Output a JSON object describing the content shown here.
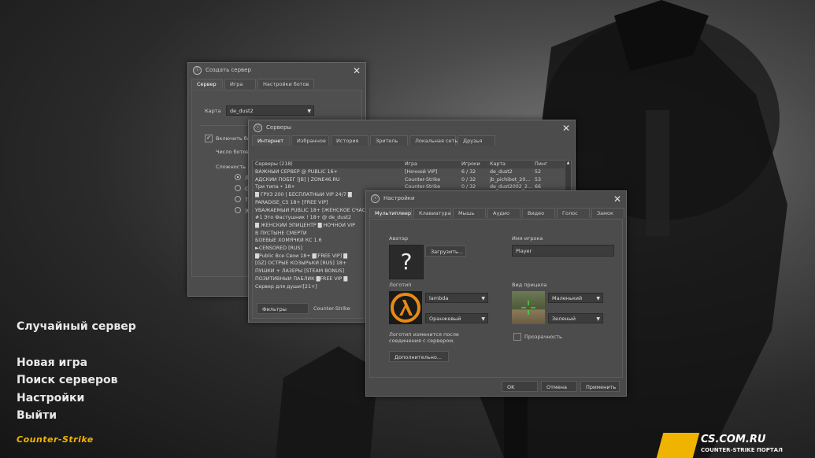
{
  "menu": {
    "random_server": "Случайный сервер",
    "new_game": "Новая игра",
    "find_servers": "Поиск серверов",
    "settings": "Настройки",
    "quit": "Выйти"
  },
  "logo_left": "Counter-Strike",
  "watermark": {
    "site": "CS.COM.RU",
    "sub": "COUNTER-STRIKE ПОРТАЛ"
  },
  "create_server": {
    "title": "Создать сервер",
    "tabs": [
      "Сервер",
      "Игра",
      "Настройки ботов"
    ],
    "map_label": "Карта",
    "map_value": "de_dust2",
    "enable_bots": "Включить бот",
    "bot_count": "Число ботов",
    "difficulty": "Сложность",
    "difficulty_options": [
      "Л",
      "Ср",
      "Тя",
      "Эк"
    ]
  },
  "servers": {
    "title": "Серверы",
    "tabs": [
      "Интернет",
      "Избранное",
      "История",
      "Зритель",
      "Локальная сеть",
      "Друзья"
    ],
    "columns": [
      "Серверы (218)",
      "Игра",
      "Игроки",
      "Карта",
      "Пинг"
    ],
    "rows": [
      {
        "name": "ВАЖНЫЙ СЕРВЕР @ PUBLIC 16+",
        "game": "[Ночной VIP]",
        "players": "6 / 32",
        "map": "de_dust2",
        "ping": "52"
      },
      {
        "name": "АДСКИЙ ПОБЕГ [JB] | ZONE46.RU",
        "game": "Counter-Strike",
        "players": "0 / 32",
        "map": "jb_pichibot_20…",
        "ping": "53"
      },
      {
        "name": "Три типа • 18+",
        "game": "Counter-Strike",
        "players": "0 / 32",
        "map": "de_dust2002_2…",
        "ping": "66"
      },
      {
        "name": "█ ГРУЗ 200 | БЕСПЛАТНЫЙ VIP 24/7 █",
        "game": "",
        "players": "",
        "map": "",
        "ping": ""
      },
      {
        "name": "PARADISE_CS 18+ [FREE VIP]",
        "game": "",
        "players": "",
        "map": "",
        "ping": ""
      },
      {
        "name": "УВАЖАЕМЫЙ PUBLIC 18+ [ЖЕНСКОЕ СЧАС",
        "game": "",
        "players": "",
        "map": "",
        "ping": ""
      },
      {
        "name": "#1 Это Фастушник ! 18+ @ de_dust2",
        "game": "",
        "players": "",
        "map": "",
        "ping": ""
      },
      {
        "name": "█ ЖЕНСКИЙ ЭПИЦЕНТР █ НОЧНОЙ VIP",
        "game": "",
        "players": "",
        "map": "",
        "ping": ""
      },
      {
        "name": "В ПУСТЫНЕ СМЕРТИ",
        "game": "",
        "players": "",
        "map": "",
        "ping": ""
      },
      {
        "name": "БОЕВЫЕ ХОМЯЧКИ КС 1.6",
        "game": "",
        "players": "",
        "map": "",
        "ping": ""
      },
      {
        "name": "►CENSORED [RUS]",
        "game": "",
        "players": "",
        "map": "",
        "ping": ""
      },
      {
        "name": "█Public Все Свои 18+ █[FREE VIP] █",
        "game": "",
        "players": "",
        "map": "",
        "ping": ""
      },
      {
        "name": "[GZ] ОСТРЫЕ КОЗЫРЬКИ [RUS] 18+",
        "game": "",
        "players": "",
        "map": "",
        "ping": ""
      },
      {
        "name": "ПУШКИ + ЛАЗЕРЫ [STEAM BONUS]",
        "game": "",
        "players": "",
        "map": "",
        "ping": ""
      },
      {
        "name": "ПОЗИТИВНЫЙ ПАБЛИК █FREE VIP █",
        "game": "",
        "players": "",
        "map": "",
        "ping": ""
      },
      {
        "name": "Сервер для души![21+]",
        "game": "",
        "players": "",
        "map": "",
        "ping": ""
      }
    ],
    "filters_button": "Фильтры",
    "filter_value": "Counter-Strike"
  },
  "settings": {
    "title": "Настройки",
    "tabs": [
      "Мультиплеер",
      "Клавиатура",
      "Мышь",
      "Аудио",
      "Видео",
      "Голос",
      "Замок"
    ],
    "avatar_label": "Аватар",
    "avatar_placeholder": "?",
    "upload_button": "Загрузить...",
    "player_name_label": "Имя игрока",
    "player_name_value": "Player",
    "logo_label": "Логотип",
    "logo_value": "lambda",
    "logo_color": "Оранжевый",
    "crosshair_label": "Вид прицела",
    "crosshair_size": "Маленький",
    "crosshair_color": "Зеленый",
    "transparency_label": "Прозрачность",
    "logo_note": "Логотип изменится после соединения с сервером.",
    "advanced_button": "Дополнительно...",
    "ok_button": "OK",
    "cancel_button": "Отмена",
    "apply_button": "Применить"
  },
  "colors": {
    "accent_orange": "#e88a14",
    "brand_yellow": "#f0b400",
    "crosshair_green": "#44d844"
  }
}
